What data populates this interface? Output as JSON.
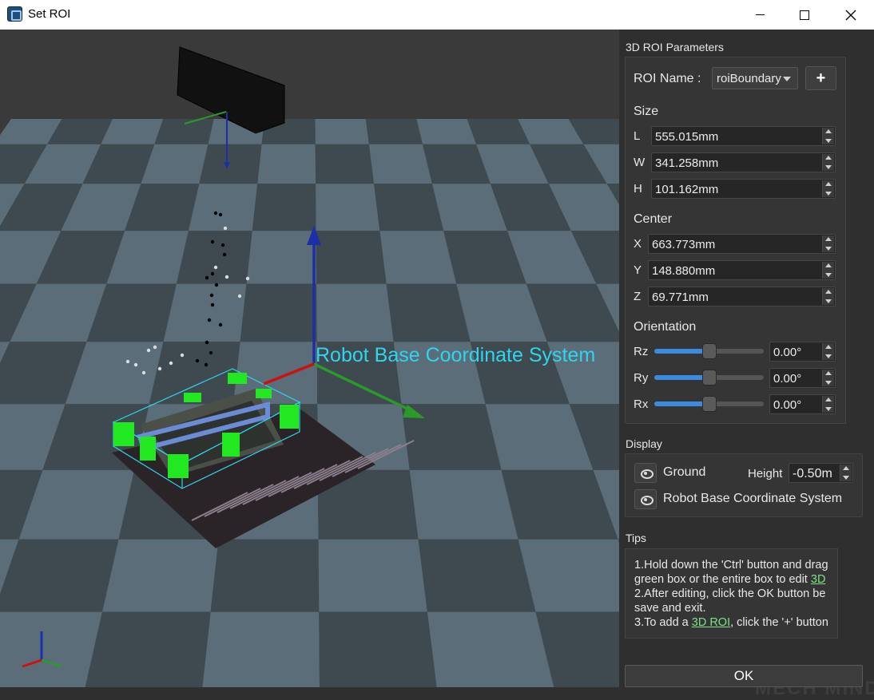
{
  "window": {
    "title": "Set ROI",
    "minimize_icon": "minimize-icon",
    "maximize_icon": "maximize-icon",
    "close_icon": "close-icon"
  },
  "viewport": {
    "label": "Robot Base Coordinate System"
  },
  "roi_params": {
    "section_title": "3D ROI Parameters",
    "roi_name_label": "ROI Name :",
    "roi_name_value": "roiBoundary",
    "add_button_label": "+",
    "size_title": "Size",
    "size": [
      {
        "axis": "L",
        "value": "555.015mm"
      },
      {
        "axis": "W",
        "value": "341.258mm"
      },
      {
        "axis": "H",
        "value": "101.162mm"
      }
    ],
    "center_title": "Center",
    "center": [
      {
        "axis": "X",
        "value": "663.773mm"
      },
      {
        "axis": "Y",
        "value": "148.880mm"
      },
      {
        "axis": "Z",
        "value": "69.771mm"
      }
    ],
    "orientation_title": "Orientation",
    "orientation": [
      {
        "axis": "Rz",
        "value": "0.00°",
        "slider_fraction": 0.5
      },
      {
        "axis": "Ry",
        "value": "0.00°",
        "slider_fraction": 0.5
      },
      {
        "axis": "Rx",
        "value": "0.00°",
        "slider_fraction": 0.5
      }
    ]
  },
  "display": {
    "section_title": "Display",
    "ground_label": "Ground",
    "height_label": "Height",
    "height_value": "-0.50m",
    "robot_base_label": "Robot Base Coordinate System"
  },
  "tips": {
    "section_title": "Tips",
    "line1": "1.Hold down the 'Ctrl' button and drag",
    "line2_pre": "green box or the entire box to edit ",
    "line2_link": "3D",
    "line3": "2.After editing, click the OK button be",
    "line4": "save and exit.",
    "line5_pre": "3.To add a ",
    "line5_link": "3D ROI",
    "line5_post": ", click the '+' button"
  },
  "ok_button_label": "OK",
  "watermark": "MECH MIND",
  "colors": {
    "viewport_bg": "#3a3a3a",
    "floor_light": "#5b6d78",
    "floor_dark": "#3f4a50",
    "label": "#2fd5ee",
    "roi_handles": "#22e822",
    "axis_x": "#cc1111",
    "axis_y": "#2a9a2a",
    "axis_z": "#1a2fa8",
    "slider_fill": "#3b8be0",
    "link": "#7fe08a"
  }
}
